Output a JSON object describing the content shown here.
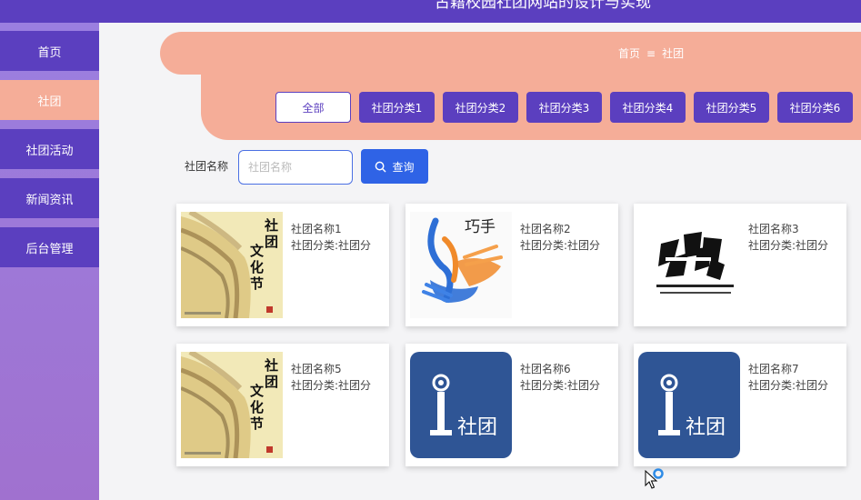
{
  "header": {
    "title": "古籍校园社团网站的设计与实现"
  },
  "sidebar": {
    "items": [
      {
        "label": "首页"
      },
      {
        "label": "社团",
        "active": true
      },
      {
        "label": "社团活动"
      },
      {
        "label": "新闻资讯"
      },
      {
        "label": "后台管理"
      }
    ]
  },
  "breadcrumb": {
    "home": "首页",
    "separator": "≡",
    "current": "社团"
  },
  "categories": [
    "全部",
    "社团分类1",
    "社团分类2",
    "社团分类3",
    "社团分类4",
    "社团分类5",
    "社团分类6"
  ],
  "search": {
    "label": "社团名称",
    "placeholder": "社团名称",
    "value": "",
    "button_label": "查询"
  },
  "cards": [
    {
      "name": "社团名称1",
      "category": "社团分类:社团分",
      "image": "calligraphy"
    },
    {
      "name": "社团名称2",
      "category": "社团分类:社团分",
      "image": "hands"
    },
    {
      "name": "社团名称3",
      "category": "社团分类:社团分",
      "image": "debate"
    },
    {
      "name": "社团名称5",
      "category": "社团分类:社团分",
      "image": "calligraphy"
    },
    {
      "name": "社团名称6",
      "category": "社团分类:社团分",
      "image": "club-logo"
    },
    {
      "name": "社团名称7",
      "category": "社团分类:社团分",
      "image": "club-logo"
    }
  ],
  "image_text": {
    "qiaoshou": "巧手",
    "club": "社团"
  },
  "colors": {
    "primary": "#5b3fbf",
    "accent": "#f5ad98",
    "search": "#2f63e6",
    "logo_bg": "#2f5595"
  }
}
